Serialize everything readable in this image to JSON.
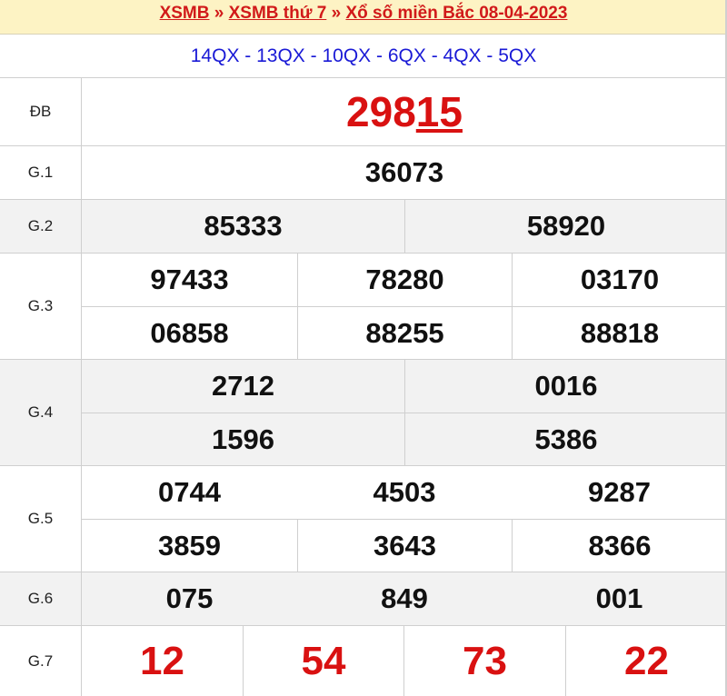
{
  "header": {
    "link1": "XSMB",
    "sep1": " » ",
    "link2": "XSMB thứ 7",
    "sep2": " » ",
    "link3": "Xổ số miền Bắc 08-04-2023"
  },
  "codes": "14QX - 13QX - 10QX - 6QX - 4QX - 5QX",
  "prizes": {
    "db": {
      "label": "ĐB",
      "value_main": "298",
      "value_tail": "15"
    },
    "g1": {
      "label": "G.1",
      "values": [
        "36073"
      ]
    },
    "g2": {
      "label": "G.2",
      "values": [
        "85333",
        "58920"
      ]
    },
    "g3": {
      "label": "G.3",
      "values": [
        "97433",
        "78280",
        "03170",
        "06858",
        "88255",
        "88818"
      ]
    },
    "g4": {
      "label": "G.4",
      "values": [
        "2712",
        "0016",
        "1596",
        "5386"
      ]
    },
    "g5": {
      "label": "G.5",
      "values": [
        "0744",
        "4503",
        "9287",
        "3859",
        "3643",
        "8366"
      ]
    },
    "g6": {
      "label": "G.6",
      "values": [
        "075",
        "849",
        "001"
      ]
    },
    "g7": {
      "label": "G.7",
      "values": [
        "12",
        "54",
        "73",
        "22"
      ]
    }
  },
  "colors": {
    "header_bg": "#fdf3c4",
    "accent_red": "#d91111",
    "code_blue": "#1a1ad6"
  }
}
